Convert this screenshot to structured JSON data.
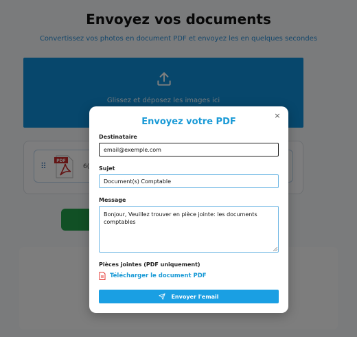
{
  "page": {
    "title": "Envoyez vos documents",
    "subtitle": "Convertissez vos photos en document PDF et envoyez les en quelques secondes",
    "dropzone_text": "Glissez et déposez les images ici",
    "file_name_partial": "6(",
    "file_icon_label": "PDF"
  },
  "modal": {
    "title": "Envoyez votre PDF",
    "close_label": "×",
    "recipient_label": "Destinataire",
    "recipient_value": "email@exemple.com",
    "subject_label": "Sujet",
    "subject_value": "Document(s) Comptable",
    "message_label": "Message",
    "message_value": "Bonjour, Veuillez trouver en pièce jointe:  les documents comptables",
    "attachments_label": "Pièces jointes (PDF uniquement)",
    "download_link": "Télécharger le document PDF",
    "send_button": "Envoyer l'email"
  },
  "colors": {
    "accent": "#1a9ad6",
    "dropzone": "#0e8fd8",
    "green_button": "#22a14a",
    "pdf_red": "#e53935"
  },
  "icons": {
    "upload": "upload-icon",
    "drag": "drag-handle-icon",
    "pdf": "pdf-file-icon",
    "close": "close-icon",
    "send": "paper-plane-icon"
  }
}
